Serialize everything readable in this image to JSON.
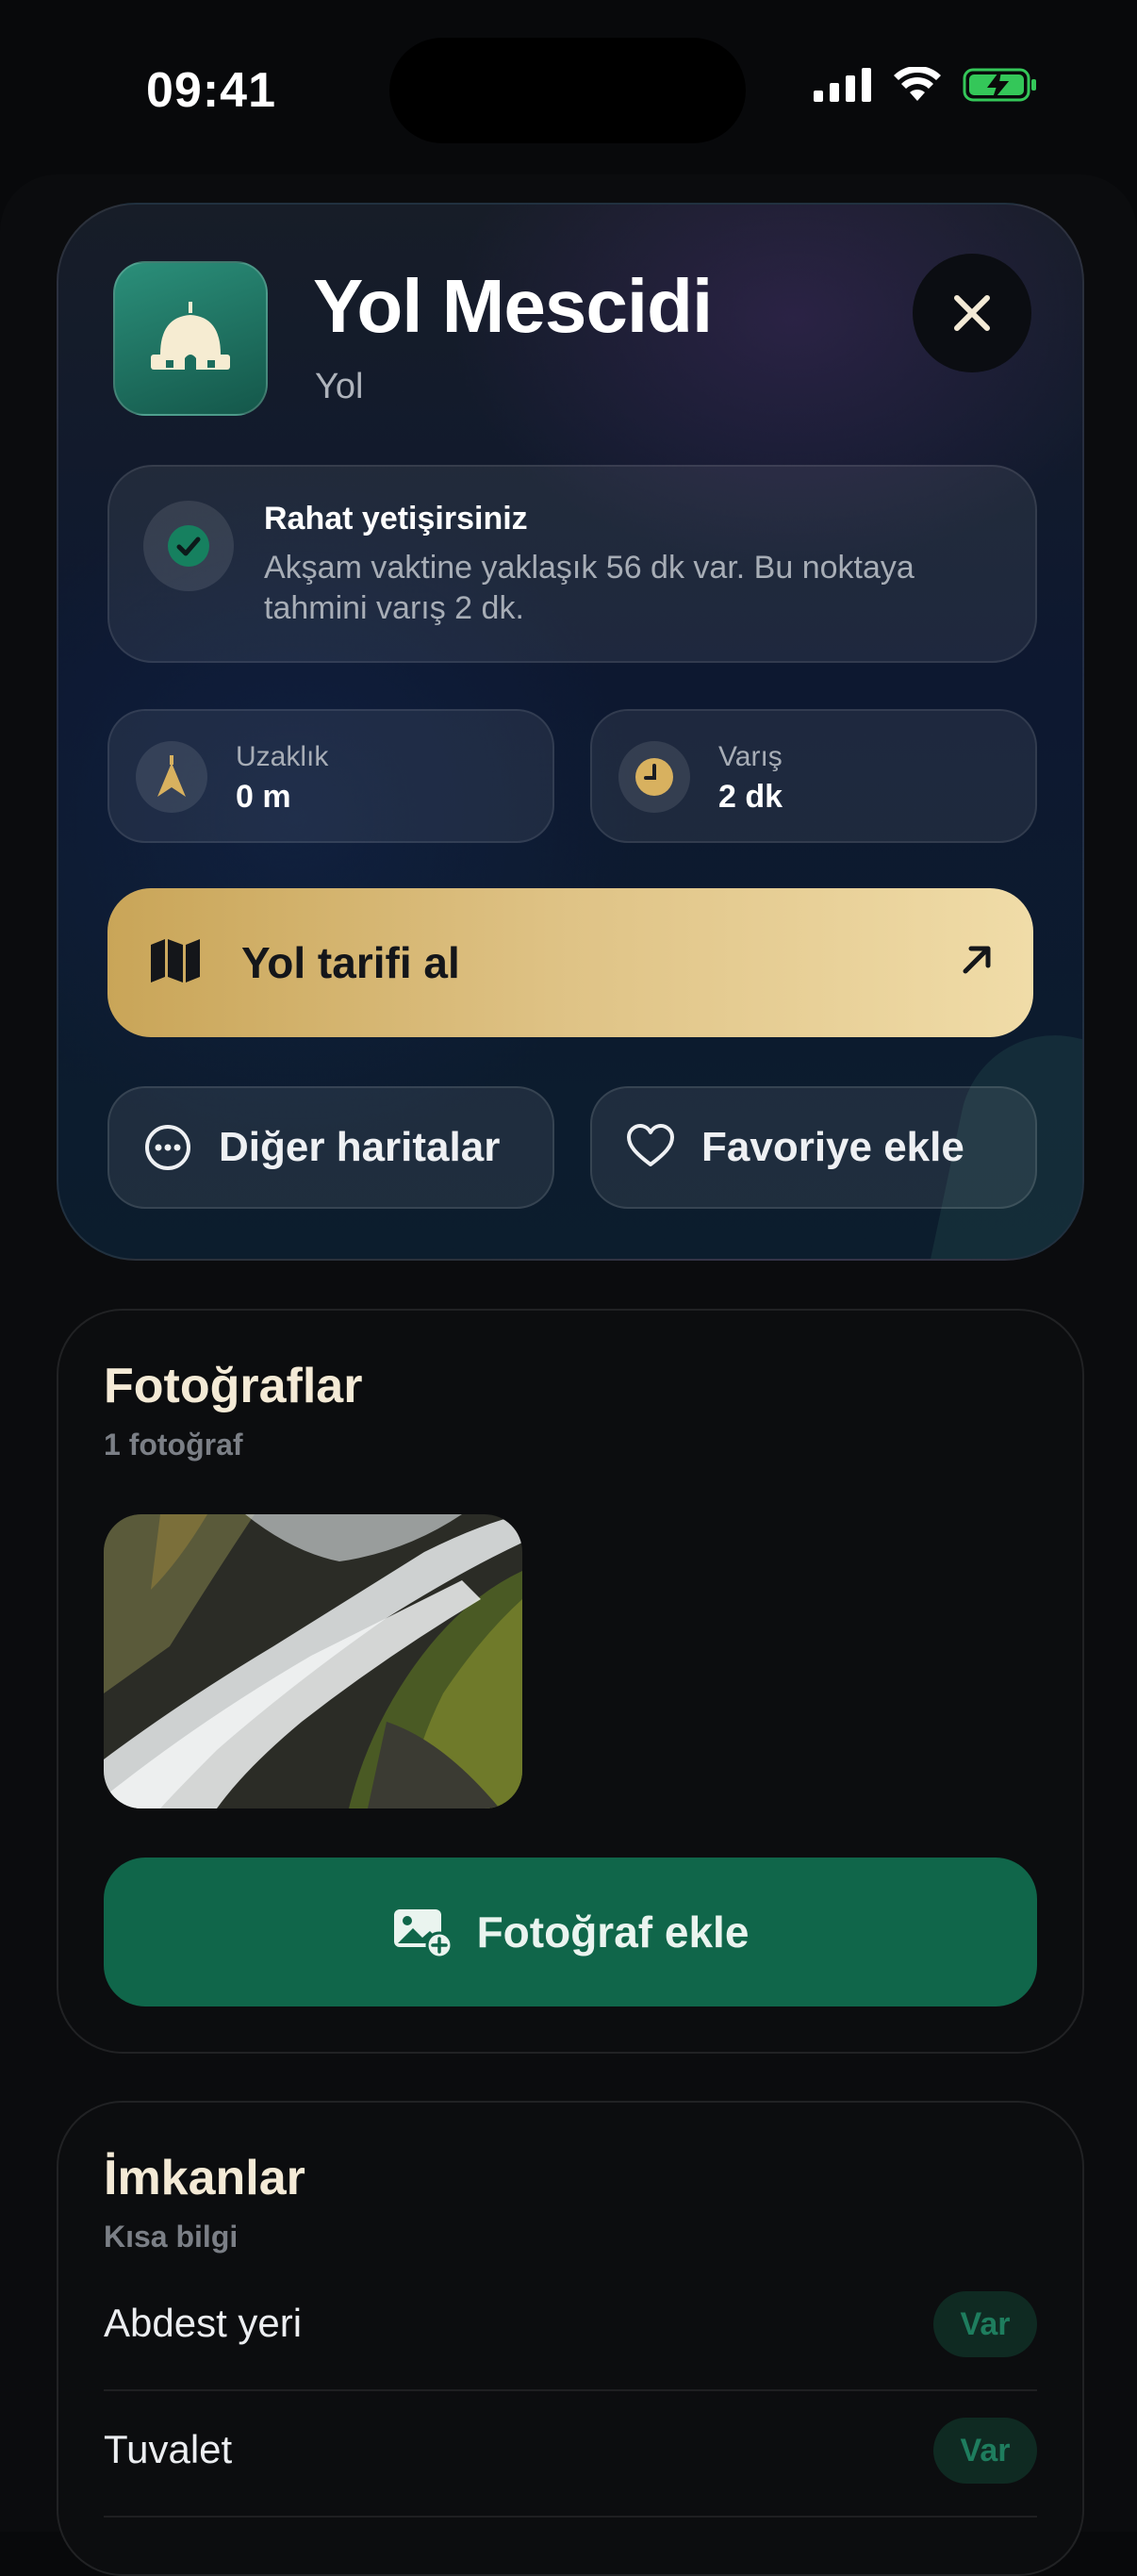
{
  "status_bar": {
    "time": "09:41"
  },
  "header": {
    "title": "Yol Mescidi",
    "subtitle": "Yol"
  },
  "notice": {
    "title": "Rahat yetişirsiniz",
    "text": "Akşam vaktine yaklaşık 56 dk var. Bu noktaya tahmini varış 2 dk."
  },
  "stats": [
    {
      "label": "Uzaklık",
      "value": "0 m",
      "icon": "compass-icon"
    },
    {
      "label": "Varış",
      "value": "2 dk",
      "icon": "clock-icon"
    }
  ],
  "actions": {
    "directions": "Yol tarifi al",
    "other_maps": "Diğer haritalar",
    "favorite": "Favoriye ekle"
  },
  "photos": {
    "title": "Fotoğraflar",
    "count": "1 fotoğraf",
    "add_label": "Fotoğraf ekle"
  },
  "amenities": {
    "title": "İmkanlar",
    "subtitle": "Kısa bilgi",
    "items": [
      {
        "label": "Abdest yeri",
        "badge": "Var"
      },
      {
        "label": "Tuvalet",
        "badge": "Var"
      }
    ]
  },
  "colors": {
    "accent_gold": "#dfc386",
    "accent_green": "#10664a",
    "title_cream": "#f4ead6"
  }
}
